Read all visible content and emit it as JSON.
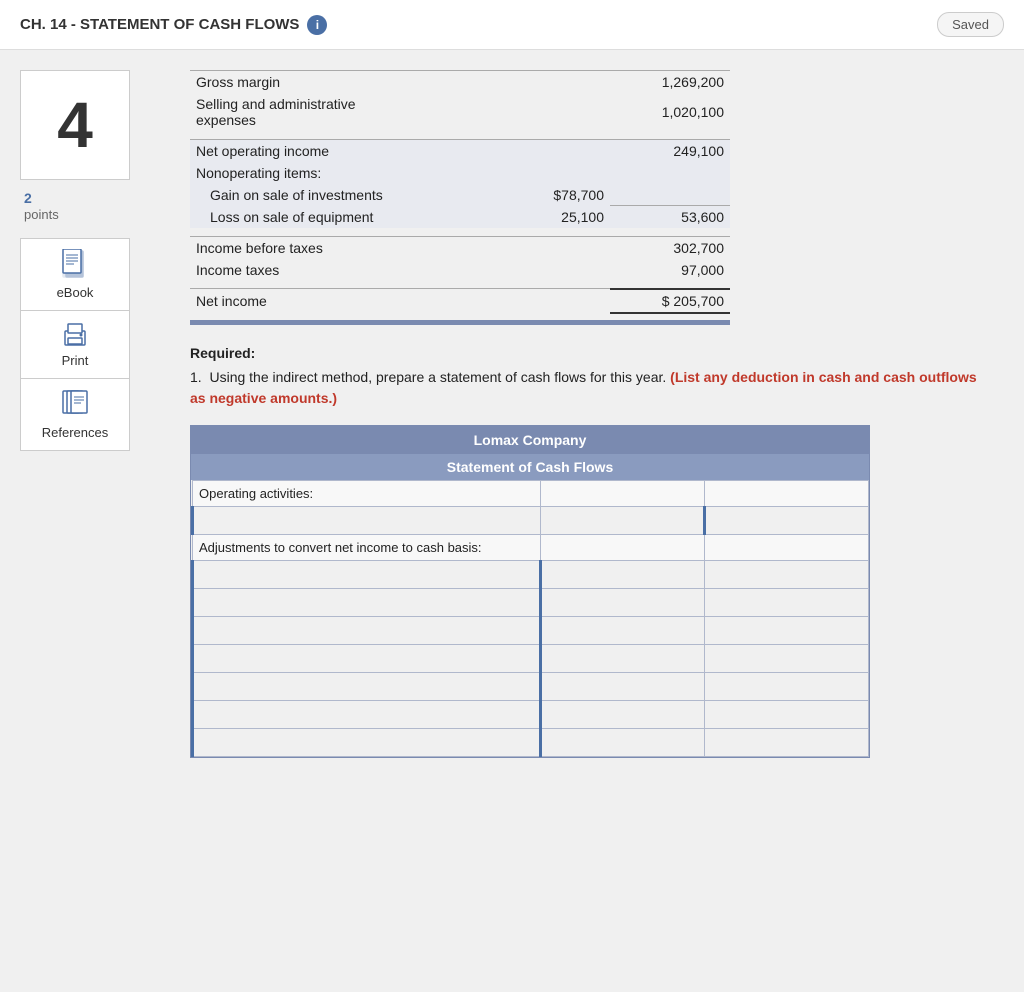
{
  "header": {
    "title": "CH. 14 - STATEMENT OF CASH FLOWS",
    "info_icon": "i",
    "saved_label": "Saved"
  },
  "sidebar": {
    "question_number": "4",
    "points_value": "2",
    "points_label": "points",
    "ebook_label": "eBook",
    "print_label": "Print",
    "references_label": "References"
  },
  "income_statement": {
    "rows": [
      {
        "label": "Gross margin",
        "sub_amount": "",
        "total": "1,269,200",
        "style": "top-border"
      },
      {
        "label": "Selling and administrative expenses",
        "sub_amount": "",
        "total": "1,020,100",
        "style": ""
      },
      {
        "label": "",
        "sub_amount": "",
        "total": "",
        "style": "spacer"
      },
      {
        "label": "Net operating income",
        "sub_amount": "",
        "total": "249,100",
        "style": "top-border section-bg"
      },
      {
        "label": "Nonoperating items:",
        "sub_amount": "",
        "total": "",
        "style": "section-bg"
      },
      {
        "label": "Gain on sale of investments",
        "sub_amount": "$78,700",
        "total": "",
        "style": "section-bg indent"
      },
      {
        "label": "Loss on sale of equipment",
        "sub_amount": "25,100",
        "total": "53,600",
        "style": "section-bg indent"
      },
      {
        "label": "",
        "sub_amount": "",
        "total": "",
        "style": "spacer"
      },
      {
        "label": "Income before taxes",
        "sub_amount": "",
        "total": "302,700",
        "style": "top-border"
      },
      {
        "label": "Income taxes",
        "sub_amount": "",
        "total": "97,000",
        "style": ""
      },
      {
        "label": "",
        "sub_amount": "",
        "total": "",
        "style": "spacer"
      },
      {
        "label": "Net income",
        "sub_amount": "",
        "total": "$ 205,700",
        "style": "top-border net-income"
      }
    ]
  },
  "required": {
    "title": "Required:",
    "instructions": [
      {
        "number": "1.",
        "text": "Using the indirect method, prepare a statement of cash flows for this year.",
        "highlight": "(List any deduction in cash and cash outflows as negative amounts.)"
      }
    ]
  },
  "cash_flow_table": {
    "company_name": "Lomax Company",
    "statement_title": "Statement of Cash Flows",
    "sections": [
      {
        "label": "Operating activities:",
        "input_rows": 1,
        "has_total_col": true
      },
      {
        "label": "Adjustments to convert net income to cash basis:",
        "input_rows": 7,
        "has_total_col": true
      }
    ]
  }
}
